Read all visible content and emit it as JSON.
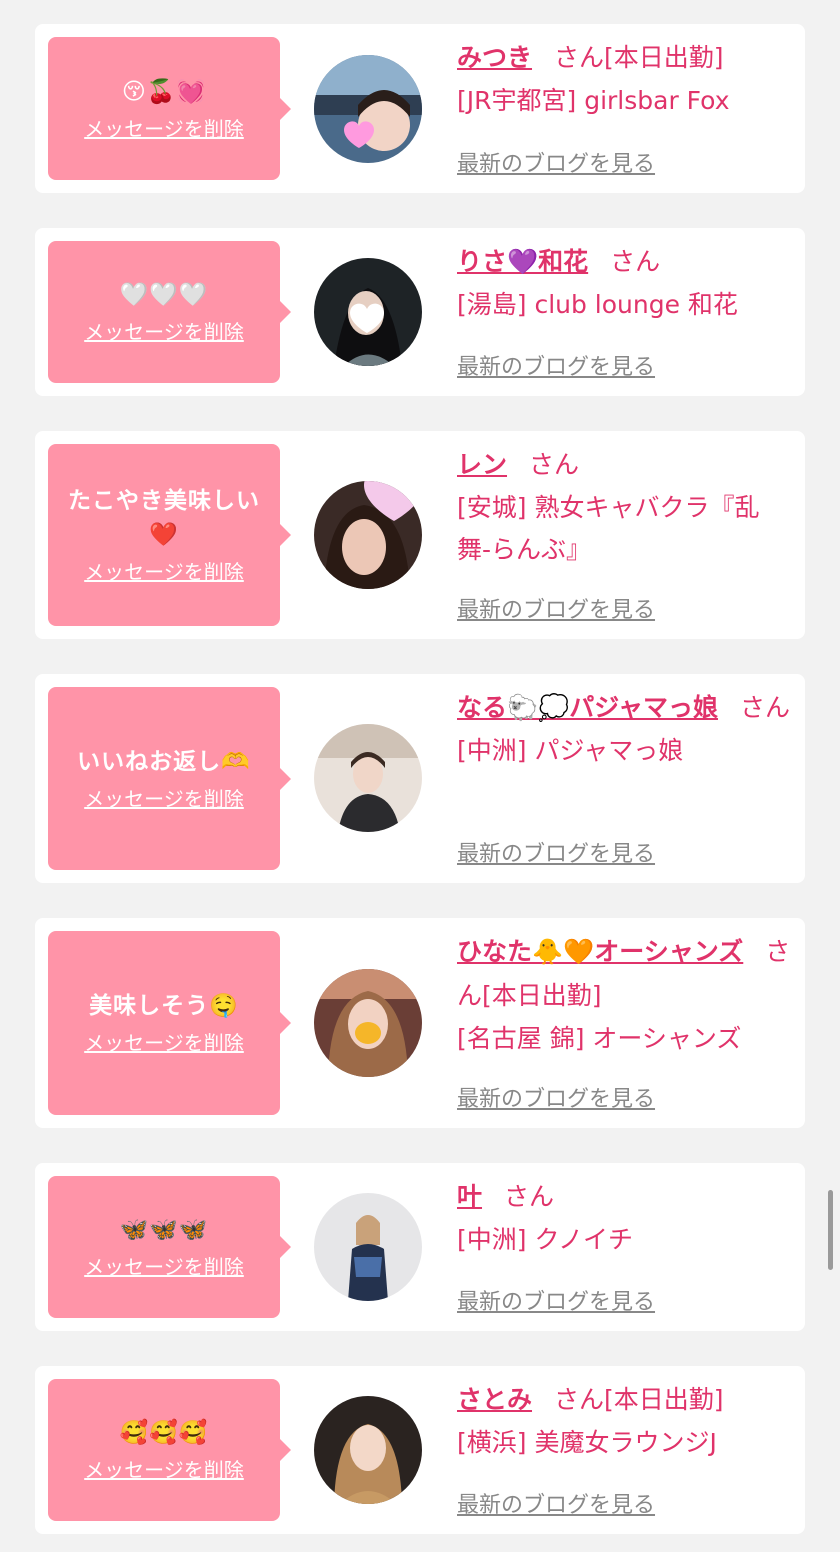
{
  "delete_label": "メッセージを削除",
  "blog_label": "最新のブログを見る",
  "san_label": "さん",
  "colors": {
    "bubble": "#ff94a8",
    "accent": "#e0336a",
    "link_gray": "#888888",
    "background": "#f2f2f2"
  },
  "messages": [
    {
      "text": "😚🍒💓",
      "name": "みつき",
      "working": "[本日出勤]",
      "shop": "[JR宇都宮] girlsbar Fox",
      "avatar_icon": "person-photo-heart-sticker"
    },
    {
      "text": "🤍🤍🤍",
      "name": "りさ💜和花",
      "working": "",
      "shop": "[湯島] club lounge 和花",
      "avatar_icon": "person-photo-heart-sticker"
    },
    {
      "text": "たこやき美味しい❤️",
      "name": "レン",
      "working": "",
      "shop": "[安城] 熟女キャバクラ『乱舞-らんぶ』",
      "avatar_icon": "person-photo-heart-sticker"
    },
    {
      "text": "いいねお返し🫶",
      "name": "なる🐑💭パジャマっ娘",
      "working": "",
      "shop": "[中洲] パジャマっ娘",
      "avatar_icon": "person-photo"
    },
    {
      "text": "美味しそう🤤",
      "name": "ひなた🐥🧡オーシャンズ",
      "working": "[本日出勤]",
      "shop": "[名古屋 錦] オーシャンズ",
      "avatar_icon": "person-photo-heart-sticker"
    },
    {
      "text": "🦋🦋🦋",
      "name": "叶",
      "working": "",
      "shop": "[中洲] クノイチ",
      "avatar_icon": "person-photo"
    },
    {
      "text": "🥰🥰🥰",
      "name": "さとみ",
      "working": "[本日出勤]",
      "shop": "[横浜] 美魔女ラウンジJ",
      "avatar_icon": "person-photo"
    }
  ]
}
